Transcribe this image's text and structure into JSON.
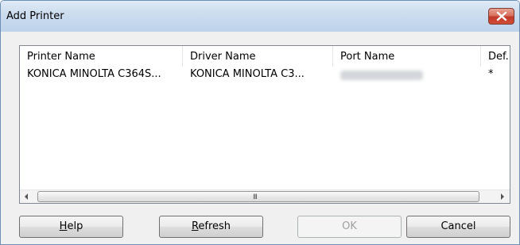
{
  "window": {
    "title": "Add Printer",
    "close_icon": "close-icon"
  },
  "list": {
    "columns": [
      "Printer Name",
      "Driver Name",
      "Port Name",
      "Def."
    ],
    "rows": [
      {
        "printer_name": "KONICA MINOLTA C364S...",
        "driver_name": "KONICA MINOLTA C3...",
        "port_name": "",
        "default": "*"
      }
    ],
    "scrollbar_grip": "III"
  },
  "buttons": {
    "help": {
      "mnemonic": "H",
      "rest": "elp"
    },
    "refresh": {
      "mnemonic": "R",
      "rest": "efresh"
    },
    "ok": "OK",
    "cancel": "Cancel"
  },
  "colors": {
    "close_button": "#c1392b",
    "titlebar": "#cbdcee",
    "dialog_background": "#f0f0f0"
  }
}
